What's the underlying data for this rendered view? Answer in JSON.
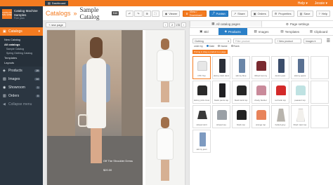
{
  "topbar": {
    "dashboard": "Dashboard",
    "help": "Help ▾",
    "user": "Jessie ▾"
  },
  "sidebar": {
    "brand_title": "Catalog Machine Samples",
    "brand_sub": "Free plan",
    "logo_text": "CATALOG MACHINE",
    "items": [
      {
        "label": "Catalogs",
        "icon": "catalog-icon",
        "active": true
      },
      {
        "label": "Products",
        "icon": "tag-icon",
        "badge": "19"
      },
      {
        "label": "Images",
        "icon": "image-icon",
        "badge": "14"
      },
      {
        "label": "Showroom",
        "icon": "showroom-icon",
        "badge": "1"
      },
      {
        "label": "Orders",
        "icon": "orders-icon",
        "badge": "0"
      },
      {
        "label": "Collapse menu",
        "icon": "collapse-icon"
      }
    ],
    "catalog_sub": [
      "New Catalog",
      "All catalogs",
      "Sample Catalog",
      "Spring Clothing Catalog",
      "Templates",
      "Layouts"
    ]
  },
  "header": {
    "crumb": "Catalogs",
    "sep": "»",
    "title": "Sample Catalog",
    "edit_tag": "Edit",
    "buttons": [
      "Viewer",
      "View / Download",
      "Publish",
      "Share",
      "Orders",
      "Properties",
      "Save",
      "Help"
    ]
  },
  "canvas": {
    "new_page": "new page",
    "page_num": "2",
    "page_total": "/ 3",
    "caption": "Off The Shoulder Dress",
    "price": "$20.00"
  },
  "panel": {
    "tabs": [
      "All catalog pages",
      "Page settings"
    ],
    "subtabs": [
      "Bkl",
      "Products",
      "Images",
      "Templates",
      "Clipboard"
    ],
    "filters": {
      "category": "Clothing",
      "product_search": "Filter product",
      "new_product": "+ New product",
      "images": "Images ▾"
    },
    "sort_label": "order by",
    "sort_options": [
      "Date",
      "Name",
      "Rank"
    ],
    "hint": "Pricing & drag a product to a page",
    "products": [
      {
        "label": "OTF Top",
        "kind": "top",
        "color": "#e7e7e7",
        "selected": true
      },
      {
        "label": "skinny dark denim",
        "kind": "pants",
        "color": "#2b2f38"
      },
      {
        "label": "skinny blue",
        "kind": "pants",
        "color": "#6a86a8"
      },
      {
        "label": "ribbed tommy",
        "kind": "top",
        "color": "#7a2a30"
      },
      {
        "label": "denim jean",
        "kind": "pants",
        "color": "#3b4d6b"
      },
      {
        "label": "skinny jeans",
        "kind": "pants",
        "color": "#5a7192"
      },
      {
        "label": "",
        "kind": "empty",
        "color": "#ffffff"
      },
      {
        "label": "skinny pink crew",
        "kind": "top",
        "color": "#2a2a2a"
      },
      {
        "label": "black pants top",
        "kind": "pants",
        "color": "#1f1f22"
      },
      {
        "label": "black tank top",
        "kind": "top",
        "color": "#262626"
      },
      {
        "label": "cheky bustier",
        "kind": "top",
        "color": "#c98a9a"
      },
      {
        "label": "red tank top",
        "kind": "top",
        "color": "#d32a2a"
      },
      {
        "label": "peasant top",
        "kind": "top",
        "color": "#bfe2e2"
      },
      {
        "label": "",
        "kind": "empty",
        "color": "#ffffff"
      },
      {
        "label": "striped skirt",
        "kind": "skirt",
        "color": "#3a3a3a"
      },
      {
        "label": "striped tee",
        "kind": "top",
        "color": "#9aa0a6"
      },
      {
        "label": "black top",
        "kind": "top",
        "color": "#222222"
      },
      {
        "label": "orange top",
        "kind": "top",
        "color": "#e8835a"
      },
      {
        "label": "belted grey",
        "kind": "dress",
        "color": "#b8b4ad"
      },
      {
        "label": "fitted maxi top",
        "kind": "dress",
        "color": "#f2f0ec"
      },
      {
        "label": "",
        "kind": "empty",
        "color": "#ffffff"
      },
      {
        "label": "skinny jean",
        "kind": "pants",
        "color": "#7d9ac0"
      }
    ]
  }
}
